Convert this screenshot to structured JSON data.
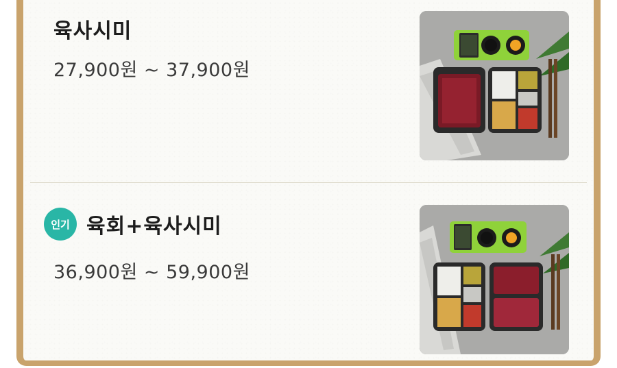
{
  "menu": {
    "items": [
      {
        "name": "육사시미",
        "price": "27,900원 ~ 37,900원",
        "badge": "",
        "photo_icon": "food-photo-yuksashimi"
      },
      {
        "name": "육회+육사시미",
        "price": "36,900원 ~ 59,900원",
        "badge": "인기",
        "photo_icon": "food-photo-yukhoe-yuksashimi"
      }
    ]
  },
  "colors": {
    "frame_border": "#c9a36c",
    "badge_bg": "#29b6a6",
    "background": "#fafaf7"
  }
}
